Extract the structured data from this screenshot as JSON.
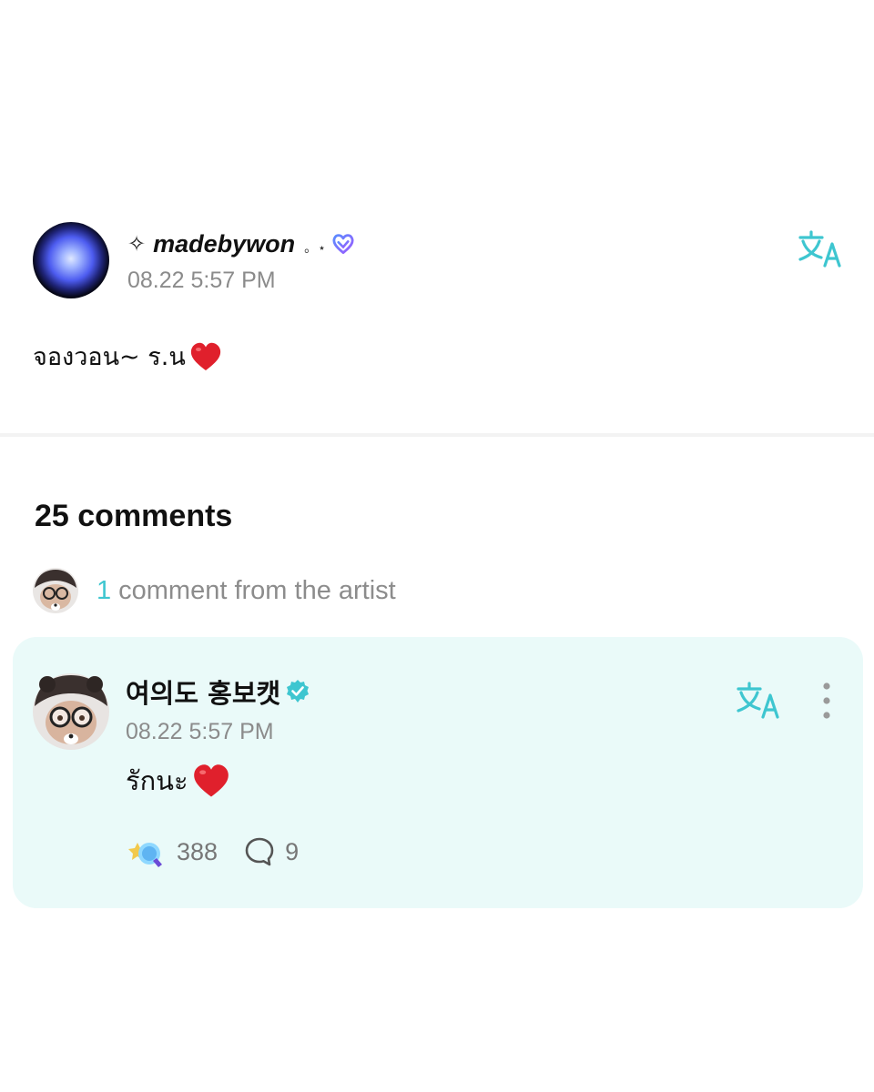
{
  "post": {
    "author": {
      "sparkle": "✧",
      "name": "madebywon",
      "decoration": "。⋆",
      "avatar": "blue-orb-avatar"
    },
    "time": "08.22 5:57 PM",
    "body": "จองวอน~ ร.น",
    "body_emoji": "red-heart-icon",
    "translate_icon": "translate-icon"
  },
  "comments": {
    "count_label": "25 comments",
    "artist_summary": {
      "count": "1",
      "label": "comment from the artist"
    },
    "items": [
      {
        "author": "여의도 홍보캣",
        "verified_icon": "verified-badge-icon",
        "time": "08.22 5:57 PM",
        "body": "รักนะ",
        "body_emoji": "red-heart-icon",
        "likes": "388",
        "replies": "9"
      }
    ]
  },
  "colors": {
    "accent": "#3ec6d0",
    "card_bg": "#eafaf9",
    "muted_text": "#8b8b8b",
    "heart": "#e0202c"
  }
}
